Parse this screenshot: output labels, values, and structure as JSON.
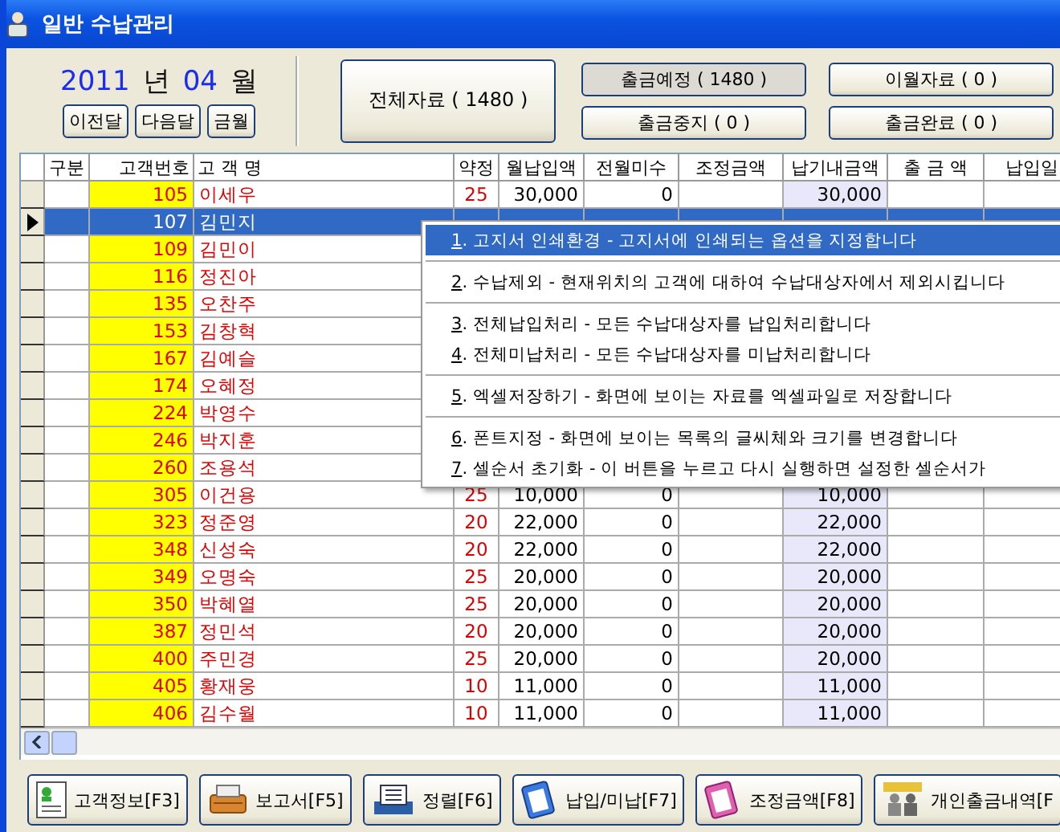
{
  "window": {
    "title": "일반 수납관리"
  },
  "period": {
    "year": "2011",
    "year_unit": "년",
    "month": "04",
    "month_unit": "월",
    "buttons": [
      "이전달",
      "다음달",
      "금월"
    ]
  },
  "all_button": {
    "label": "전체자료 ( 1480 )"
  },
  "filters": [
    {
      "label": "출금예정 ( 1480 )",
      "selected": true
    },
    {
      "label": "이월자료 ( 0 )",
      "selected": false
    },
    {
      "label": "출금중지 ( 0 )",
      "selected": false
    },
    {
      "label": "출금완료 ( 0 )",
      "selected": false
    }
  ],
  "table": {
    "columns": [
      "구분",
      "고객번호",
      "고 객 명",
      "약정",
      "월납입액",
      "전월미수",
      "조정금액",
      "납기내금액",
      "출 금 액",
      "납입일"
    ],
    "rows": [
      {
        "number": "105",
        "name": "이세우",
        "term": "25",
        "monthly": "30,000",
        "arrears": "0",
        "due": "30,000",
        "selected": false
      },
      {
        "number": "107",
        "name": "김민지",
        "selected": true
      },
      {
        "number": "109",
        "name": "김민이",
        "selected": false
      },
      {
        "number": "116",
        "name": "정진아",
        "selected": false
      },
      {
        "number": "135",
        "name": "오찬주",
        "selected": false
      },
      {
        "number": "153",
        "name": "김창혁",
        "selected": false
      },
      {
        "number": "167",
        "name": "김예슬",
        "selected": false
      },
      {
        "number": "174",
        "name": "오혜정",
        "selected": false
      },
      {
        "number": "224",
        "name": "박영수",
        "selected": false
      },
      {
        "number": "246",
        "name": "박지훈",
        "selected": false
      },
      {
        "number": "260",
        "name": "조용석",
        "selected": false
      },
      {
        "number": "305",
        "name": "이건용",
        "term": "25",
        "monthly": "10,000",
        "arrears": "0",
        "due": "10,000",
        "selected": false
      },
      {
        "number": "323",
        "name": "정준영",
        "term": "20",
        "monthly": "22,000",
        "arrears": "0",
        "due": "22,000",
        "selected": false
      },
      {
        "number": "348",
        "name": "신성숙",
        "term": "20",
        "monthly": "22,000",
        "arrears": "0",
        "due": "22,000",
        "selected": false
      },
      {
        "number": "349",
        "name": "오명숙",
        "term": "25",
        "monthly": "20,000",
        "arrears": "0",
        "due": "20,000",
        "selected": false
      },
      {
        "number": "350",
        "name": "박혜열",
        "term": "25",
        "monthly": "20,000",
        "arrears": "0",
        "due": "20,000",
        "selected": false
      },
      {
        "number": "387",
        "name": "정민석",
        "term": "20",
        "monthly": "20,000",
        "arrears": "0",
        "due": "20,000",
        "selected": false
      },
      {
        "number": "400",
        "name": "주민경",
        "term": "25",
        "monthly": "20,000",
        "arrears": "0",
        "due": "20,000",
        "selected": false
      },
      {
        "number": "405",
        "name": "황재웅",
        "term": "10",
        "monthly": "11,000",
        "arrears": "0",
        "due": "11,000",
        "selected": false
      },
      {
        "number": "406",
        "name": "김수월",
        "term": "10",
        "monthly": "11,000",
        "arrears": "0",
        "due": "11,000",
        "selected": false
      }
    ]
  },
  "context_menu": {
    "groups": [
      [
        {
          "key": "1",
          "text": ". 고지서 인쇄환경 - 고지서에 인쇄되는 옵션을 지정합니다",
          "selected": true
        }
      ],
      [
        {
          "key": "2",
          "text": ". 수납제외 - 현재위치의 고객에 대하여 수납대상자에서 제외시킵니다",
          "selected": false
        }
      ],
      [
        {
          "key": "3",
          "text": ". 전체납입처리 - 모든 수납대상자를 납입처리합니다",
          "selected": false
        },
        {
          "key": "4",
          "text": ". 전체미납처리 - 모든 수납대상자를 미납처리합니다",
          "selected": false
        }
      ],
      [
        {
          "key": "5",
          "text": ". 엑셀저장하기 - 화면에 보이는 자료를 엑셀파일로 저장합니다",
          "selected": false
        }
      ],
      [
        {
          "key": "6",
          "text": ". 폰트지정 - 화면에 보이는  목록의 글씨체와 크기를 변경합니다",
          "selected": false
        },
        {
          "key": "7",
          "text": ". 셀순서 초기화 - 이 버튼을 누르고 다시 실행하면 설정한 셀순서가",
          "selected": false
        }
      ]
    ]
  },
  "toolbar": [
    {
      "kind": "customer",
      "label": "고객정보[F3]"
    },
    {
      "kind": "printer",
      "label": "보고서[F5]"
    },
    {
      "kind": "sort",
      "label": "정렬[F6]"
    },
    {
      "kind": "clipboard",
      "label": "납입/미납[F7]"
    },
    {
      "kind": "adjust",
      "label": "조정금액[F8]"
    },
    {
      "kind": "history",
      "label": "개인출금내역[F"
    }
  ]
}
